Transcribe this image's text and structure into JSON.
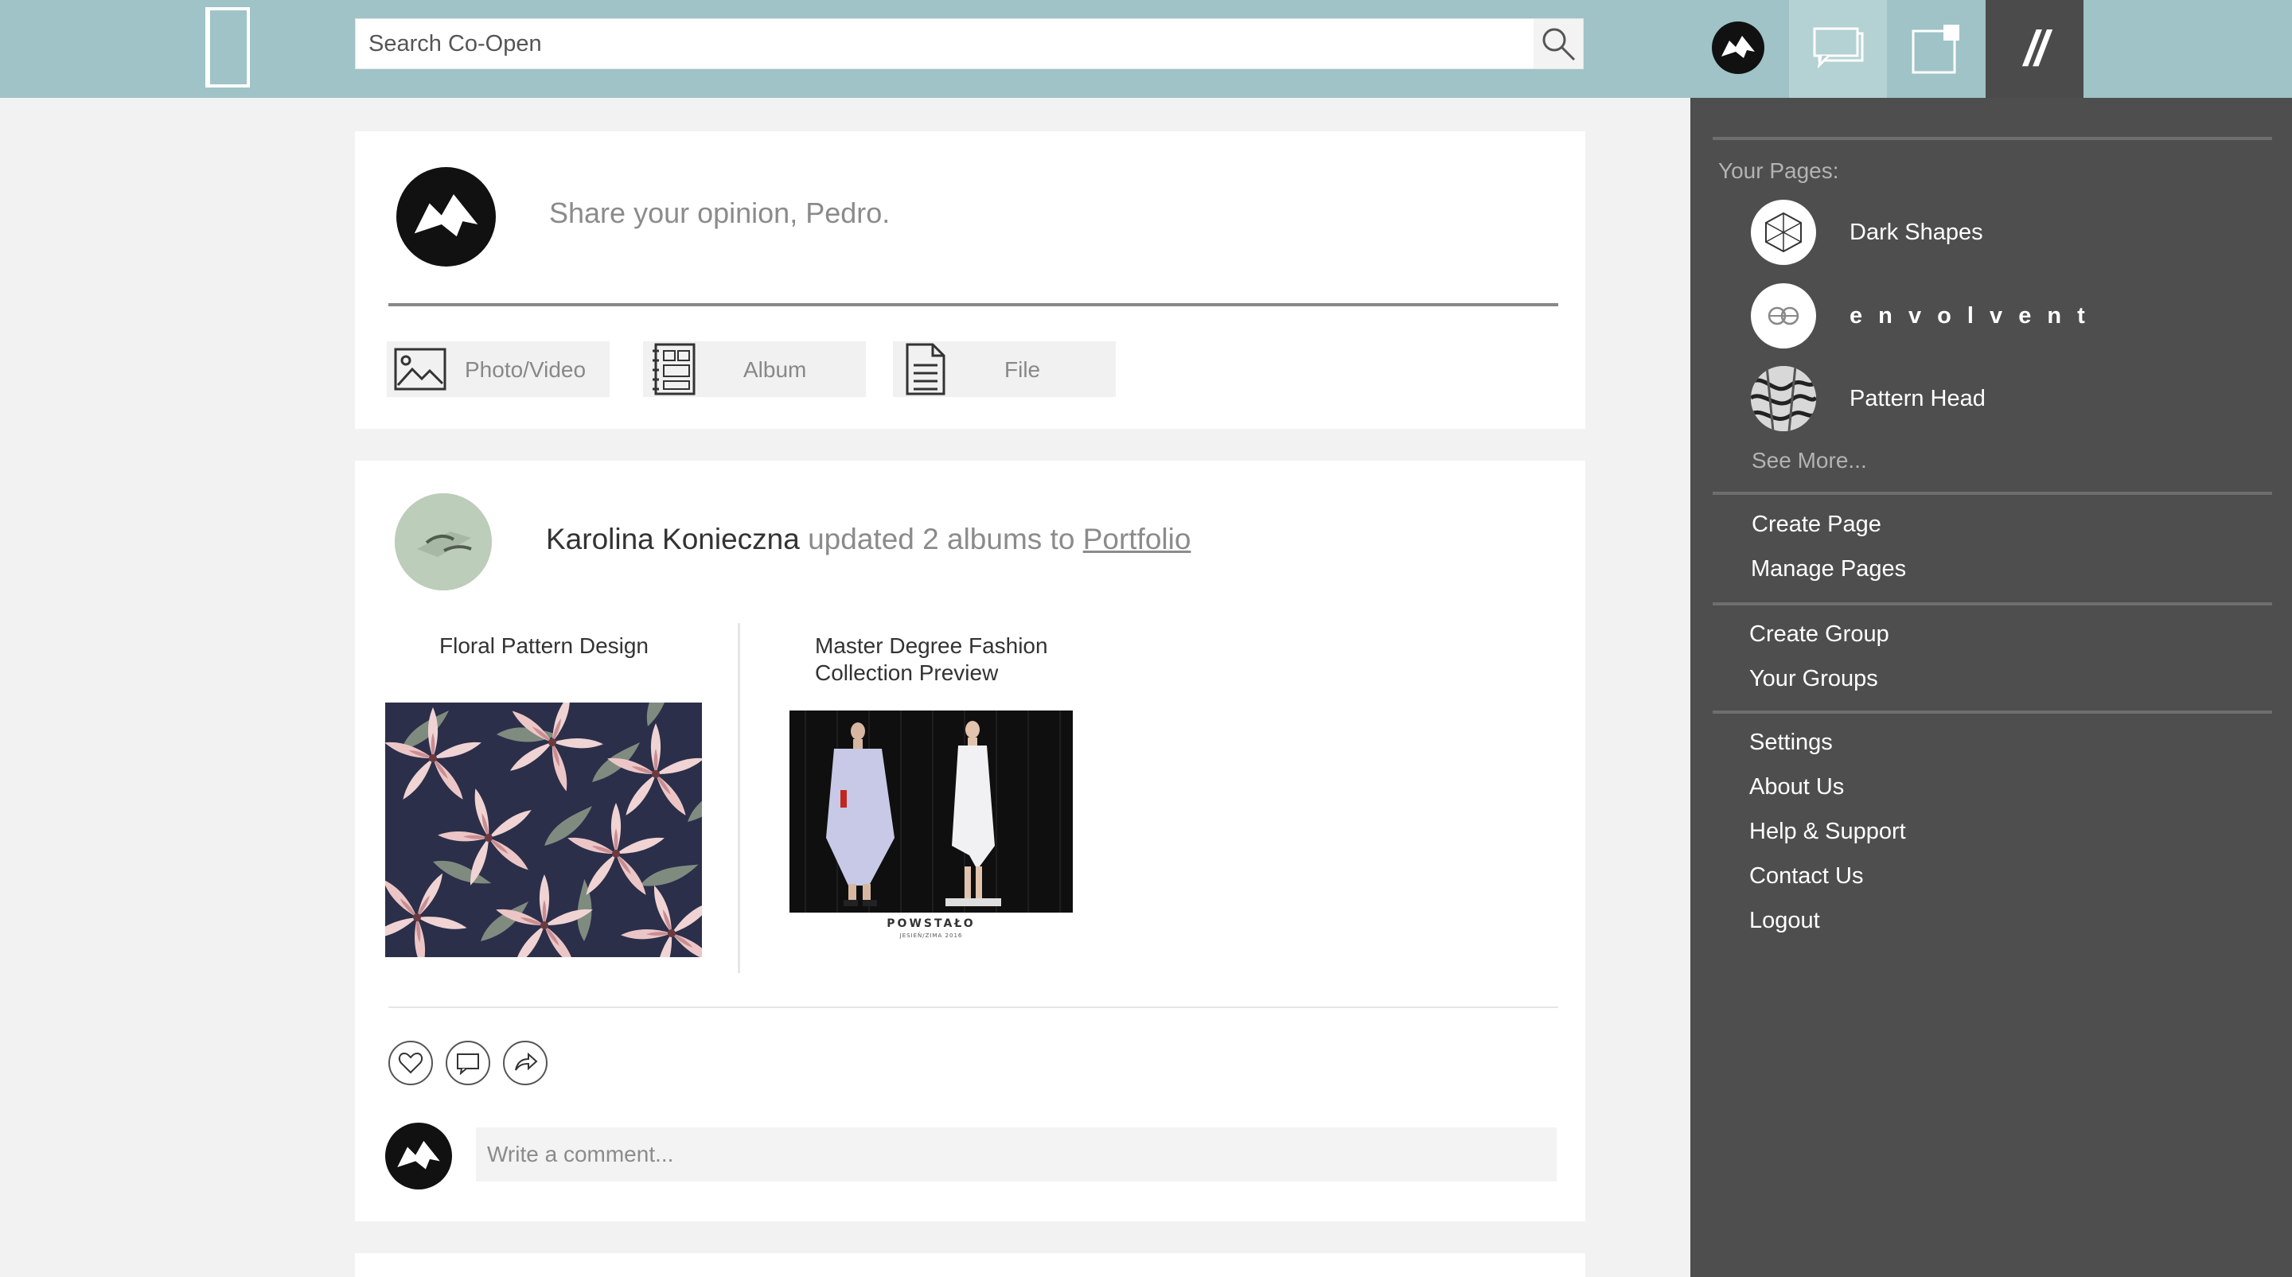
{
  "search": {
    "placeholder": "Search Co-Open"
  },
  "composer": {
    "prompt": "Share your opinion, Pedro.",
    "attachments": [
      {
        "label": "Photo/Video",
        "icon": "image-icon"
      },
      {
        "label": "Album",
        "icon": "album-icon"
      },
      {
        "label": "File",
        "icon": "file-icon"
      }
    ]
  },
  "post": {
    "author": "Karolina Konieczna",
    "action": "updated 2 albums to",
    "target": "Portfolio",
    "albums": [
      {
        "title": "Floral Pattern Design"
      },
      {
        "title": "Master Degree Fashion Collection Preview",
        "caption": "POWSTAŁO",
        "subcaption": "JESIEŃ/ZIMA 2016"
      }
    ],
    "comment_placeholder": "Write a comment..."
  },
  "sidemenu": {
    "pages_heading": "Your Pages:",
    "pages": [
      {
        "name": "Dark Shapes"
      },
      {
        "name": "e n v o l v e n t"
      },
      {
        "name": "Pattern Head"
      }
    ],
    "see_more": "See More...",
    "page_links": [
      "Create Page",
      "Manage Pages"
    ],
    "group_links": [
      "Create Group",
      "Your Groups"
    ],
    "account_links": [
      "Settings",
      "About Us",
      "Help & Support",
      "Contact Us",
      "Logout"
    ]
  },
  "colors": {
    "topbar": "#9fc3c7",
    "menu_bg": "#4e4e4e",
    "page_bg": "#f2f2f2"
  }
}
